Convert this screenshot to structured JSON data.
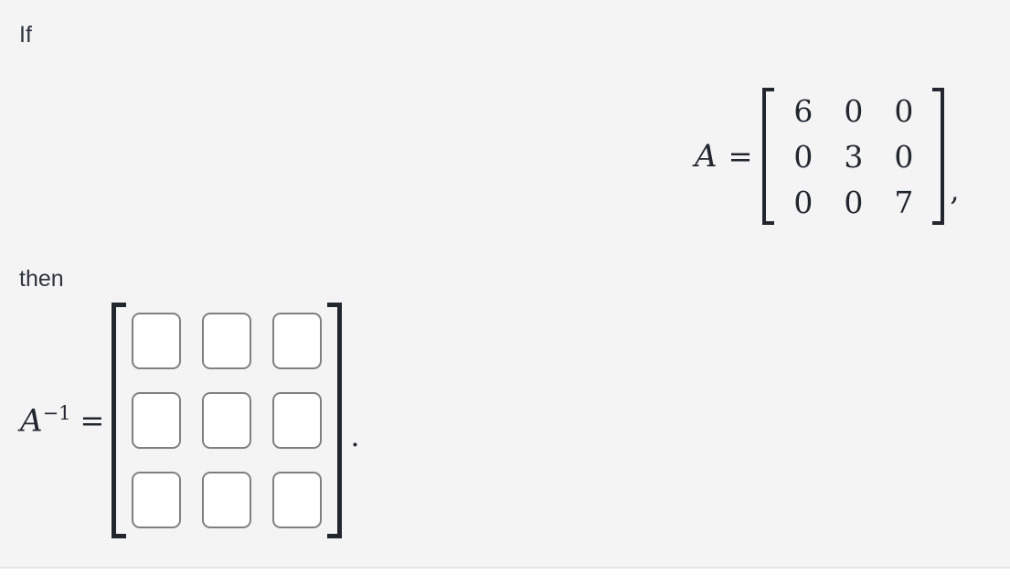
{
  "theme": {
    "panel_background": "#f4f4f4",
    "page_background": "#ffffff",
    "divider": "#e3e3e3",
    "text_color": "#2e3440",
    "math_color": "#22262e",
    "input_border": "#808080",
    "input_fill": "#ffffff"
  },
  "problem": {
    "intro_text": "If",
    "conclusion_text": "then"
  },
  "given": {
    "variable_label": "A",
    "equals_sign": "=",
    "bracket_open": "[",
    "bracket_close": "]",
    "trailing_punctuation": ",",
    "matrix": {
      "rows": 3,
      "cols": 3,
      "values": [
        [
          "6",
          "0",
          "0"
        ],
        [
          "0",
          "3",
          "0"
        ],
        [
          "0",
          "0",
          "7"
        ]
      ]
    }
  },
  "answer": {
    "variable_base": "A",
    "variable_exponent": "−1",
    "equals_sign": "=",
    "bracket_open": "[",
    "bracket_close": "]",
    "trailing_punctuation": ".",
    "input_matrix": {
      "rows": 3,
      "cols": 3,
      "placeholder": "",
      "values": [
        [
          "",
          "",
          ""
        ],
        [
          "",
          "",
          ""
        ],
        [
          "",
          "",
          ""
        ]
      ]
    }
  }
}
